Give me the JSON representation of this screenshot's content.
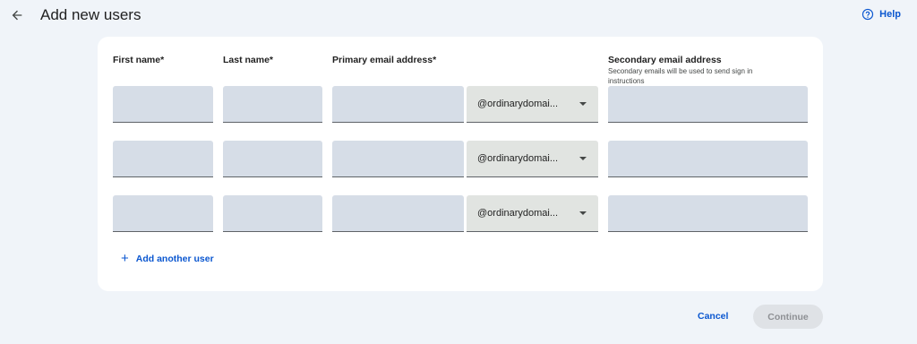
{
  "header": {
    "title": "Add new users",
    "help_label": "Help"
  },
  "form": {
    "columns": {
      "first_name": "First name*",
      "last_name": "Last name*",
      "primary_email": "Primary email address*",
      "secondary_email": "Secondary email address",
      "secondary_email_hint": "Secondary emails will be used to send sign in instructions"
    },
    "rows": [
      {
        "first_name": "",
        "last_name": "",
        "primary_email": "",
        "domain": "@ordinarydomai...",
        "secondary_email": ""
      },
      {
        "first_name": "",
        "last_name": "",
        "primary_email": "",
        "domain": "@ordinarydomai...",
        "secondary_email": ""
      },
      {
        "first_name": "",
        "last_name": "",
        "primary_email": "",
        "domain": "@ordinarydomai...",
        "secondary_email": ""
      }
    ],
    "add_user_label": "Add another user"
  },
  "footer": {
    "cancel_label": "Cancel",
    "continue_label": "Continue"
  },
  "icons": {
    "back": "arrow-back-icon",
    "help": "help-circle-icon",
    "add": "plus-icon",
    "dropdown": "caret-down-icon"
  },
  "colors": {
    "accent": "#0b57d0",
    "page_bg": "#f0f4f9",
    "field_bg": "#d6dde7",
    "select_bg": "#e1e4e1",
    "disabled_button_bg": "#dfe2e6"
  }
}
